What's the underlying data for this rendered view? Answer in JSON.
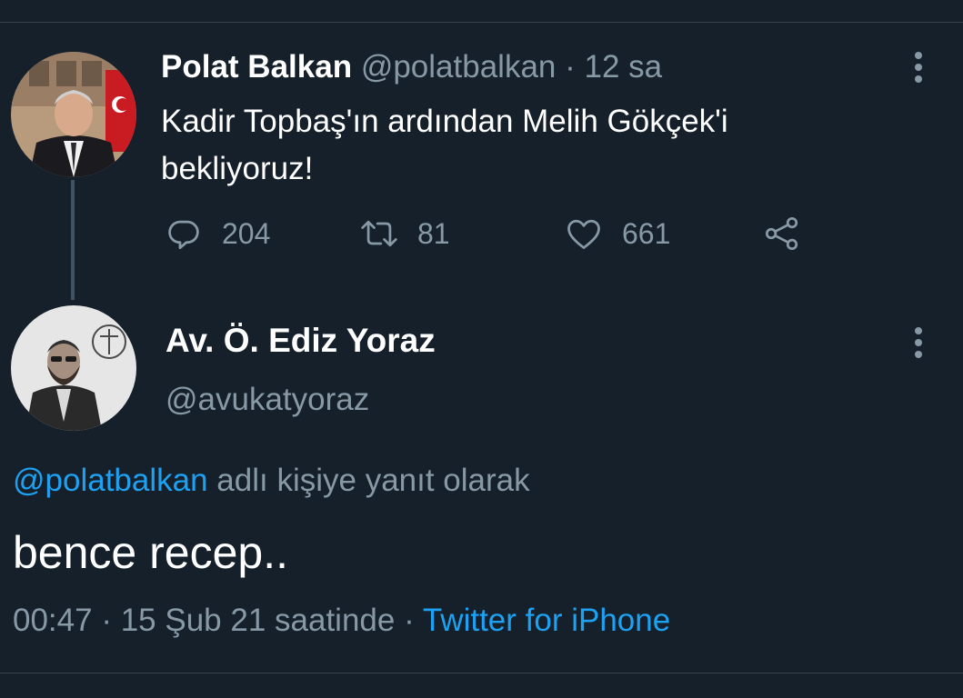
{
  "colors": {
    "background": "#15202b",
    "text_primary": "#ffffff",
    "text_secondary": "#8899a6",
    "link": "#1da1f2",
    "divider": "#38444d",
    "thread_line": "#3d5466"
  },
  "parent_tweet": {
    "author_name": "Polat Balkan",
    "author_handle": "@polatbalkan",
    "separator": "·",
    "time": "12 sa",
    "text": "Kadir Topbaş'ın ardından Melih Gökçek'i bekliyoruz!",
    "avatar_icon": "profile-photo",
    "more_icon": "vertical-dots-icon",
    "actions": {
      "reply": {
        "icon": "reply-bubble-icon",
        "count": "204"
      },
      "retweet": {
        "icon": "retweet-icon",
        "count": "81"
      },
      "like": {
        "icon": "heart-icon",
        "count": "661"
      },
      "share": {
        "icon": "share-icon"
      }
    }
  },
  "reply_tweet": {
    "author_name": "Av. Ö. Ediz Yoraz",
    "author_handle": "@avukatyoraz",
    "avatar_icon": "profile-photo",
    "more_icon": "vertical-dots-icon",
    "replying_to_handle": "@polatbalkan",
    "replying_to_suffix": " adlı kişiye yanıt olarak",
    "text": "bence recep..",
    "time": "00:47",
    "date": "15 Şub 21 saatinde",
    "separator": "·",
    "source": "Twitter for iPhone"
  }
}
